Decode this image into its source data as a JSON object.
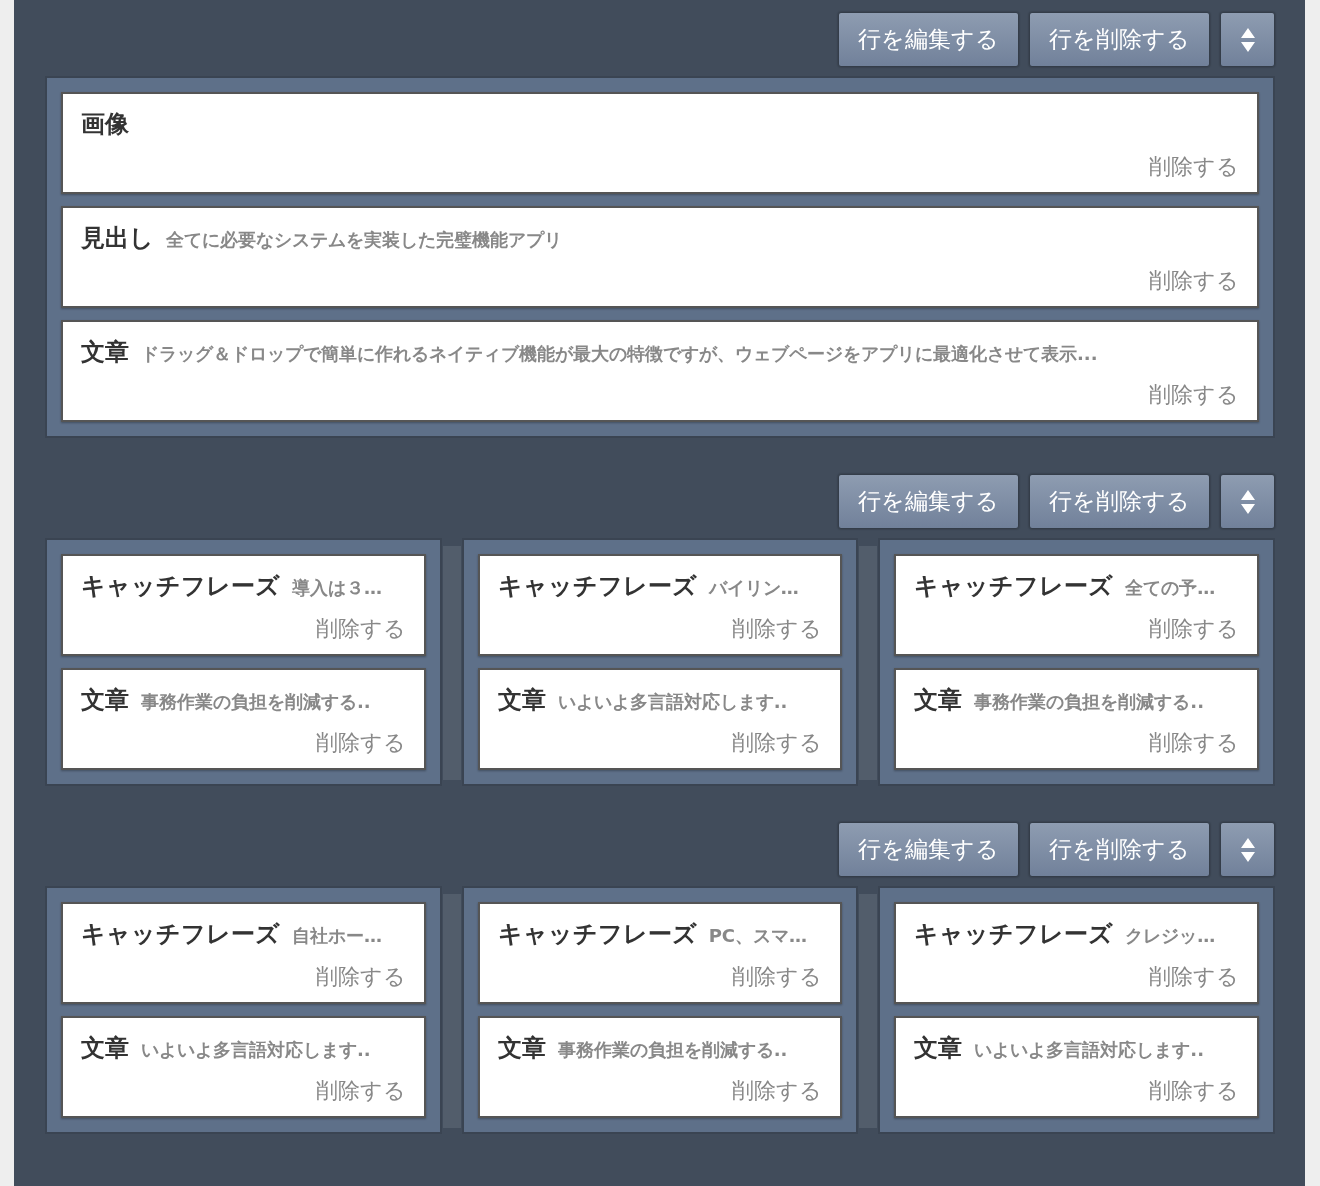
{
  "rows": [
    {
      "edit_button": "行を編集する",
      "delete_button": "行を削除する",
      "columns": [
        {
          "blocks": [
            {
              "title": "画像",
              "delete_link": "削除する"
            },
            {
              "title": "見出し",
              "summary": "全てに必要なシステムを実装した完璧機能アプリ",
              "delete_link": "削除する"
            },
            {
              "title": "文章",
              "summary": "ドラッグ＆ドロップで簡単に作れるネイティブ機能が最大の特徴ですが、ウェブページをアプリに最適化させて表示...",
              "delete_link": "削除する"
            }
          ]
        }
      ]
    },
    {
      "edit_button": "行を編集する",
      "delete_button": "行を削除する",
      "columns": [
        {
          "blocks": [
            {
              "title": "キャッチフレーズ",
              "summary": "導入は３…",
              "delete_link": "削除する"
            },
            {
              "title": "文章",
              "summary": "事務作業の負担を削減する..",
              "delete_link": "削除する"
            }
          ]
        },
        {
          "blocks": [
            {
              "title": "キャッチフレーズ",
              "summary": "バイリン…",
              "delete_link": "削除する"
            },
            {
              "title": "文章",
              "summary": "いよいよ多言語対応します..",
              "delete_link": "削除する"
            }
          ]
        },
        {
          "blocks": [
            {
              "title": "キャッチフレーズ",
              "summary": "全ての予…",
              "delete_link": "削除する"
            },
            {
              "title": "文章",
              "summary": "事務作業の負担を削減する..",
              "delete_link": "削除する"
            }
          ]
        }
      ]
    },
    {
      "edit_button": "行を編集する",
      "delete_button": "行を削除する",
      "columns": [
        {
          "blocks": [
            {
              "title": "キャッチフレーズ",
              "summary": "自社ホー…",
              "delete_link": "削除する"
            },
            {
              "title": "文章",
              "summary": "いよいよ多言語対応します..",
              "delete_link": "削除する"
            }
          ]
        },
        {
          "blocks": [
            {
              "title": "キャッチフレーズ",
              "summary": "PC、スマ…",
              "delete_link": "削除する"
            },
            {
              "title": "文章",
              "summary": "事務作業の負担を削減する..",
              "delete_link": "削除する"
            }
          ]
        },
        {
          "blocks": [
            {
              "title": "キャッチフレーズ",
              "summary": "クレジッ…",
              "delete_link": "削除する"
            },
            {
              "title": "文章",
              "summary": "いよいよ多言語対応します..",
              "delete_link": "削除する"
            }
          ]
        }
      ]
    }
  ]
}
